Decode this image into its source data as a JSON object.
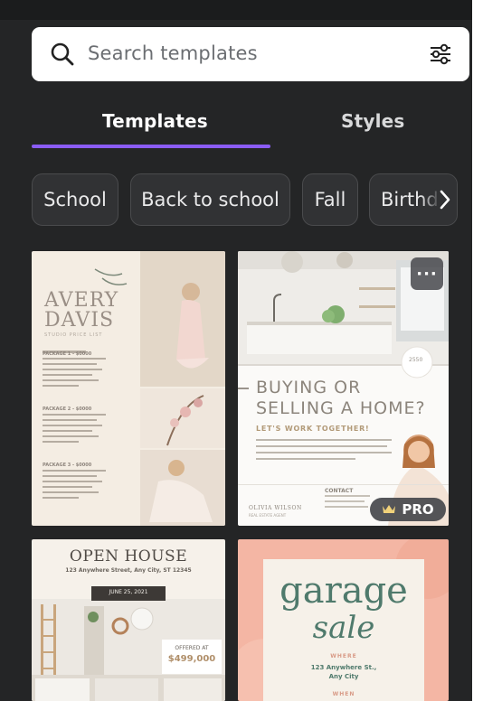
{
  "search": {
    "placeholder": "Search templates",
    "icon": "search-icon",
    "filter_icon": "sliders-icon"
  },
  "tabs": [
    {
      "label": "Templates",
      "active": true
    },
    {
      "label": "Styles",
      "active": false
    }
  ],
  "accent": "#8b5cf6",
  "chips": [
    "School",
    "Back to school",
    "Fall",
    "Birthd"
  ],
  "cards": {
    "avery": {
      "name_line1": "AVERY",
      "name_line2": "DAVIS",
      "sub": "STUDIO PRICE LIST",
      "sections": [
        "PACKAGE 1 - $0000",
        "PACKAGE 2 - $0000",
        "PACKAGE 3 - $0000"
      ]
    },
    "home": {
      "headline1": "BUYING OR",
      "headline2": "SELLING A HOME?",
      "sub": "LET'S WORK TOGETHER!",
      "name": "OLIVIA WILSON",
      "name_sub": "REAL ESTATE AGENT",
      "contact": "CONTACT",
      "badge_num": "2550",
      "badge": "PRO"
    },
    "open": {
      "title": "OPEN HOUSE",
      "address": "123 Anywhere Street, Any City, ST 12345",
      "date": "JUNE 25, 2021",
      "offered": "OFFERED AT",
      "price": "$499,000"
    },
    "garage": {
      "line1": "garage",
      "line2": "sale",
      "where": "WHERE",
      "address1": "123 Anywhere St.,",
      "address2": "Any City",
      "when": "WHEN"
    }
  }
}
